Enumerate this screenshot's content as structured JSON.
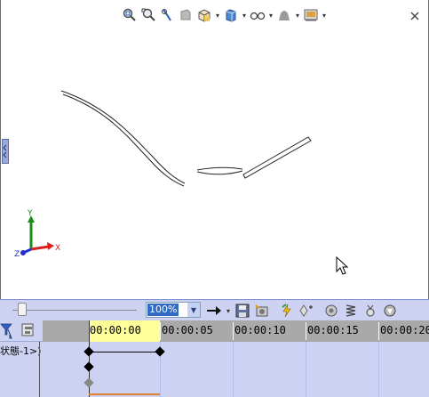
{
  "view_toolbar": {
    "icons": [
      "zoom-to-fit-icon",
      "zoom-to-area-icon",
      "rotate-view-icon",
      "section-view-icon",
      "view-orientation-icon",
      "display-style-icon",
      "hide-show-items-icon",
      "edit-appearance-icon",
      "apply-scene-icon"
    ]
  },
  "triad": {
    "x_label": "X",
    "y_label": "Y",
    "z_label": "Z",
    "colors": {
      "x": "#d92020",
      "y": "#1e8a1e",
      "z": "#2030c8"
    }
  },
  "motion_manager": {
    "zoom_value": "100%",
    "tree_label": "状態-1>)",
    "timeline": {
      "labels": [
        "00:00:00",
        "00:00:05",
        "00:00:10",
        "00:00:15",
        "00:00:20"
      ],
      "key_start": "00:00:00",
      "key_end": "00:00:05"
    },
    "tool_icons": [
      "play-arrow-icon",
      "save-animation-icon",
      "animation-wizard-icon",
      "autokey-icon",
      "add-key-icon",
      "motors-icon",
      "spring-icon",
      "contact-icon",
      "gravity-icon"
    ]
  },
  "colors": {
    "motion_bg": "#cdd2f2",
    "playback_window": "#ffff99",
    "timeline_header": "#a9a9a9",
    "zoom_selected": "#316ac5"
  }
}
